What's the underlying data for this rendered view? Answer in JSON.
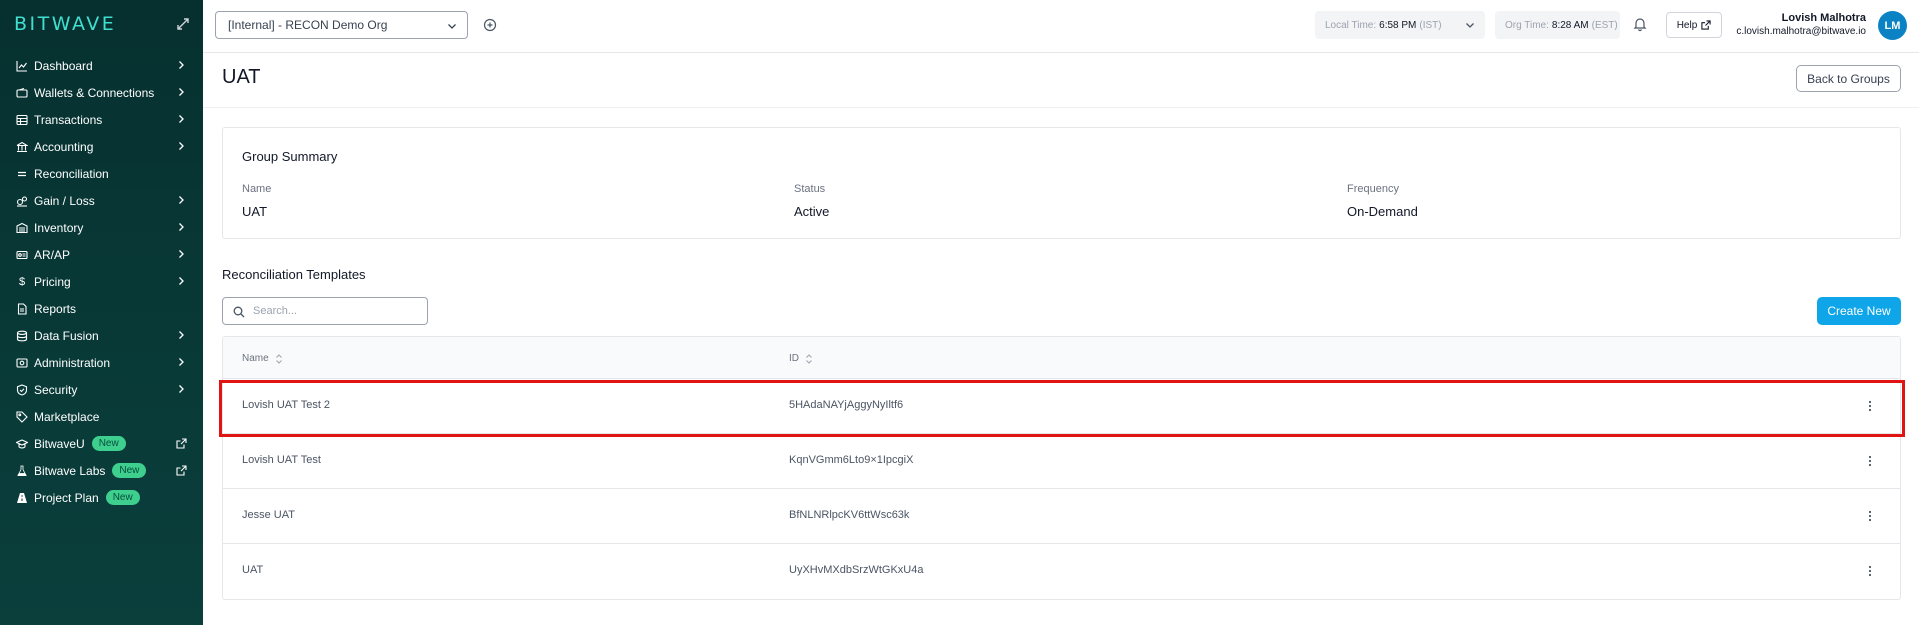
{
  "sidebar": {
    "brand": "BITWAVE",
    "items": [
      {
        "label": "Dashboard",
        "icon": "chart-line-icon",
        "chevron": true
      },
      {
        "label": "Wallets & Connections",
        "icon": "wallet-icon",
        "chevron": true
      },
      {
        "label": "Transactions",
        "icon": "table-icon",
        "chevron": true
      },
      {
        "label": "Accounting",
        "icon": "bank-icon",
        "chevron": true
      },
      {
        "label": "Reconciliation",
        "icon": "equals-icon",
        "chevron": false
      },
      {
        "label": "Gain / Loss",
        "icon": "scale-icon",
        "chevron": true
      },
      {
        "label": "Inventory",
        "icon": "warehouse-icon",
        "chevron": true
      },
      {
        "label": "AR/AP",
        "icon": "invoice-icon",
        "chevron": true
      },
      {
        "label": "Pricing",
        "icon": "dollar-icon",
        "chevron": true
      },
      {
        "label": "Reports",
        "icon": "document-icon",
        "chevron": false
      },
      {
        "label": "Data Fusion",
        "icon": "database-icon",
        "chevron": true
      },
      {
        "label": "Administration",
        "icon": "admin-icon",
        "chevron": true
      },
      {
        "label": "Security",
        "icon": "shield-icon",
        "chevron": true
      },
      {
        "label": "Marketplace",
        "icon": "tag-icon",
        "chevron": false
      },
      {
        "label": "BitwaveU",
        "icon": "graduation-cap-icon",
        "badge": "New",
        "external": true
      },
      {
        "label": "Bitwave Labs",
        "icon": "flask-icon",
        "badge": "New",
        "external": true
      },
      {
        "label": "Project Plan",
        "icon": "road-icon",
        "badge": "New",
        "external": false
      }
    ]
  },
  "topbar": {
    "org": "[Internal] - RECON Demo Org",
    "local_time_label": "Local Time:",
    "local_time": "6:58 PM",
    "local_tz": "(IST)",
    "org_time_label": "Org Time:",
    "org_time": "8:28 AM",
    "org_tz": "(EST)",
    "help": "Help",
    "user_name": "Lovish Malhotra",
    "user_email": "c.lovish.malhotra@bitwave.io",
    "avatar_initials": "LM"
  },
  "page": {
    "title": "UAT",
    "back_button": "Back to Groups"
  },
  "summary": {
    "title": "Group Summary",
    "fields": [
      {
        "key": "Name",
        "value": "UAT"
      },
      {
        "key": "Status",
        "value": "Active"
      },
      {
        "key": "Frequency",
        "value": "On-Demand"
      }
    ]
  },
  "templates": {
    "title": "Reconciliation Templates",
    "search_placeholder": "Search...",
    "create_button": "Create New",
    "columns": [
      "Name",
      "ID"
    ],
    "rows": [
      {
        "name": "Lovish UAT Test 2",
        "id": "5HAdaNAYjAggyNyIltf6",
        "highlighted": true
      },
      {
        "name": "Lovish UAT Test",
        "id": "KqnVGmm6Lto9×1IpcgiX"
      },
      {
        "name": "Jesse UAT",
        "id": "BfNLNRlpcKV6ttWsc63k"
      },
      {
        "name": "UAT",
        "id": "UyXHvMXdbSrzWtGKxU4a"
      }
    ]
  },
  "colors": {
    "sidebar_bg": "#06302f",
    "brand": "#40e0d0",
    "accent": "#0ea5e9",
    "badge": "#3ecf8e",
    "highlight": "#e11414",
    "avatar": "#0b82c4"
  }
}
